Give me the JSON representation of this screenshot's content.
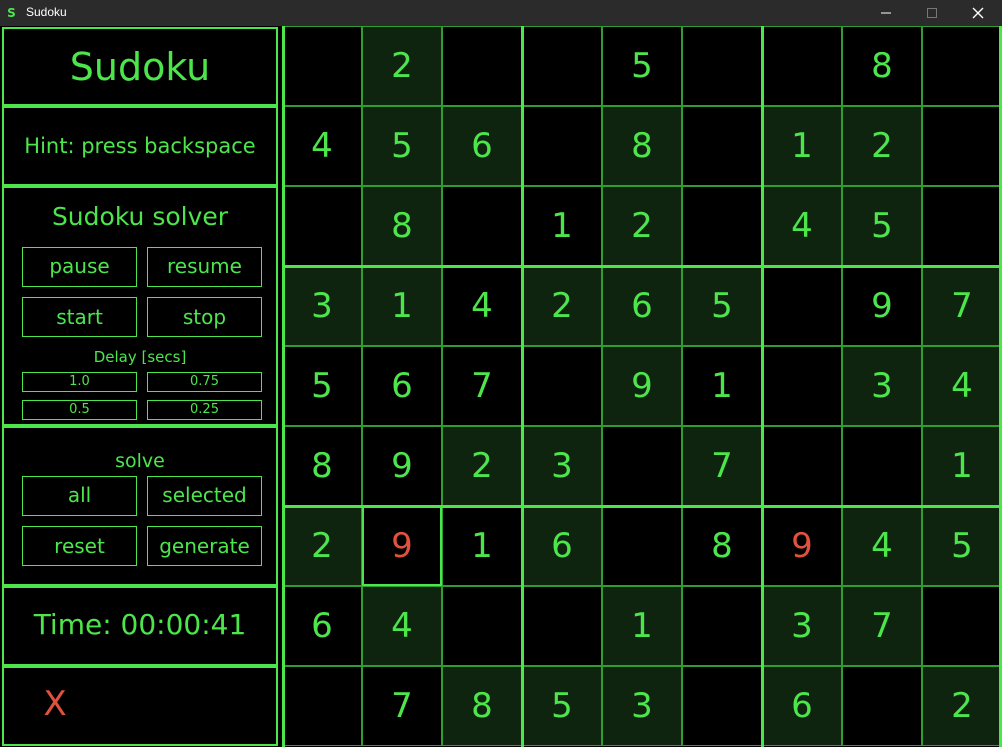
{
  "window": {
    "title": "Sudoku"
  },
  "panel": {
    "heading": "Sudoku",
    "hint": "Hint: press backspace",
    "solver_title": "Sudoku solver",
    "buttons": {
      "pause": "pause",
      "resume": "resume",
      "start": "start",
      "stop": "stop"
    },
    "delay_label": "Delay [secs]",
    "delays": [
      "1.0",
      "0.75",
      "0.5",
      "0.25"
    ],
    "solve_label": "solve",
    "solve_buttons": {
      "all": "all",
      "selected": "selected",
      "reset": "reset",
      "generate": "generate"
    },
    "time": "Time: 00:00:41",
    "exit_mark": "X"
  },
  "colors": {
    "accent": "#4ce64c",
    "error": "#e0523c",
    "shade": "#0f240f",
    "titlebar": "#2b2b2b"
  },
  "grid": {
    "rows": [
      [
        "",
        "2",
        "",
        "",
        "5",
        "",
        "",
        "8",
        ""
      ],
      [
        "4",
        "5",
        "6",
        "",
        "8",
        "",
        "1",
        "2",
        ""
      ],
      [
        "",
        "8",
        "",
        "1",
        "2",
        "",
        "4",
        "5",
        ""
      ],
      [
        "3",
        "1",
        "4",
        "2",
        "6",
        "5",
        "",
        "9",
        "7"
      ],
      [
        "5",
        "6",
        "7",
        "",
        "9",
        "1",
        "",
        "3",
        "4"
      ],
      [
        "8",
        "9",
        "2",
        "3",
        "",
        "7",
        "",
        "",
        "1"
      ],
      [
        "2",
        "9",
        "1",
        "6",
        "",
        "8",
        "9",
        "4",
        "5"
      ],
      [
        "6",
        "4",
        "",
        "",
        "1",
        "",
        "3",
        "7",
        ""
      ],
      [
        "",
        "7",
        "8",
        "5",
        "3",
        "",
        "6",
        "",
        "2"
      ]
    ],
    "shaded": [
      [
        0,
        1
      ],
      [
        1,
        1
      ],
      [
        1,
        2
      ],
      [
        1,
        4
      ],
      [
        1,
        6
      ],
      [
        1,
        7
      ],
      [
        2,
        1
      ],
      [
        2,
        4
      ],
      [
        2,
        6
      ],
      [
        2,
        7
      ],
      [
        3,
        0
      ],
      [
        3,
        1
      ],
      [
        3,
        3
      ],
      [
        3,
        4
      ],
      [
        3,
        5
      ],
      [
        3,
        8
      ],
      [
        4,
        4
      ],
      [
        4,
        7
      ],
      [
        4,
        8
      ],
      [
        5,
        2
      ],
      [
        5,
        3
      ],
      [
        5,
        5
      ],
      [
        5,
        8
      ],
      [
        6,
        0
      ],
      [
        6,
        3
      ],
      [
        6,
        7
      ],
      [
        6,
        8
      ],
      [
        7,
        1
      ],
      [
        7,
        4
      ],
      [
        7,
        6
      ],
      [
        7,
        7
      ],
      [
        8,
        2
      ],
      [
        8,
        3
      ],
      [
        8,
        4
      ],
      [
        8,
        6
      ],
      [
        8,
        8
      ]
    ],
    "red": [
      [
        6,
        1
      ],
      [
        6,
        6
      ]
    ],
    "selected": [
      6,
      1
    ]
  }
}
